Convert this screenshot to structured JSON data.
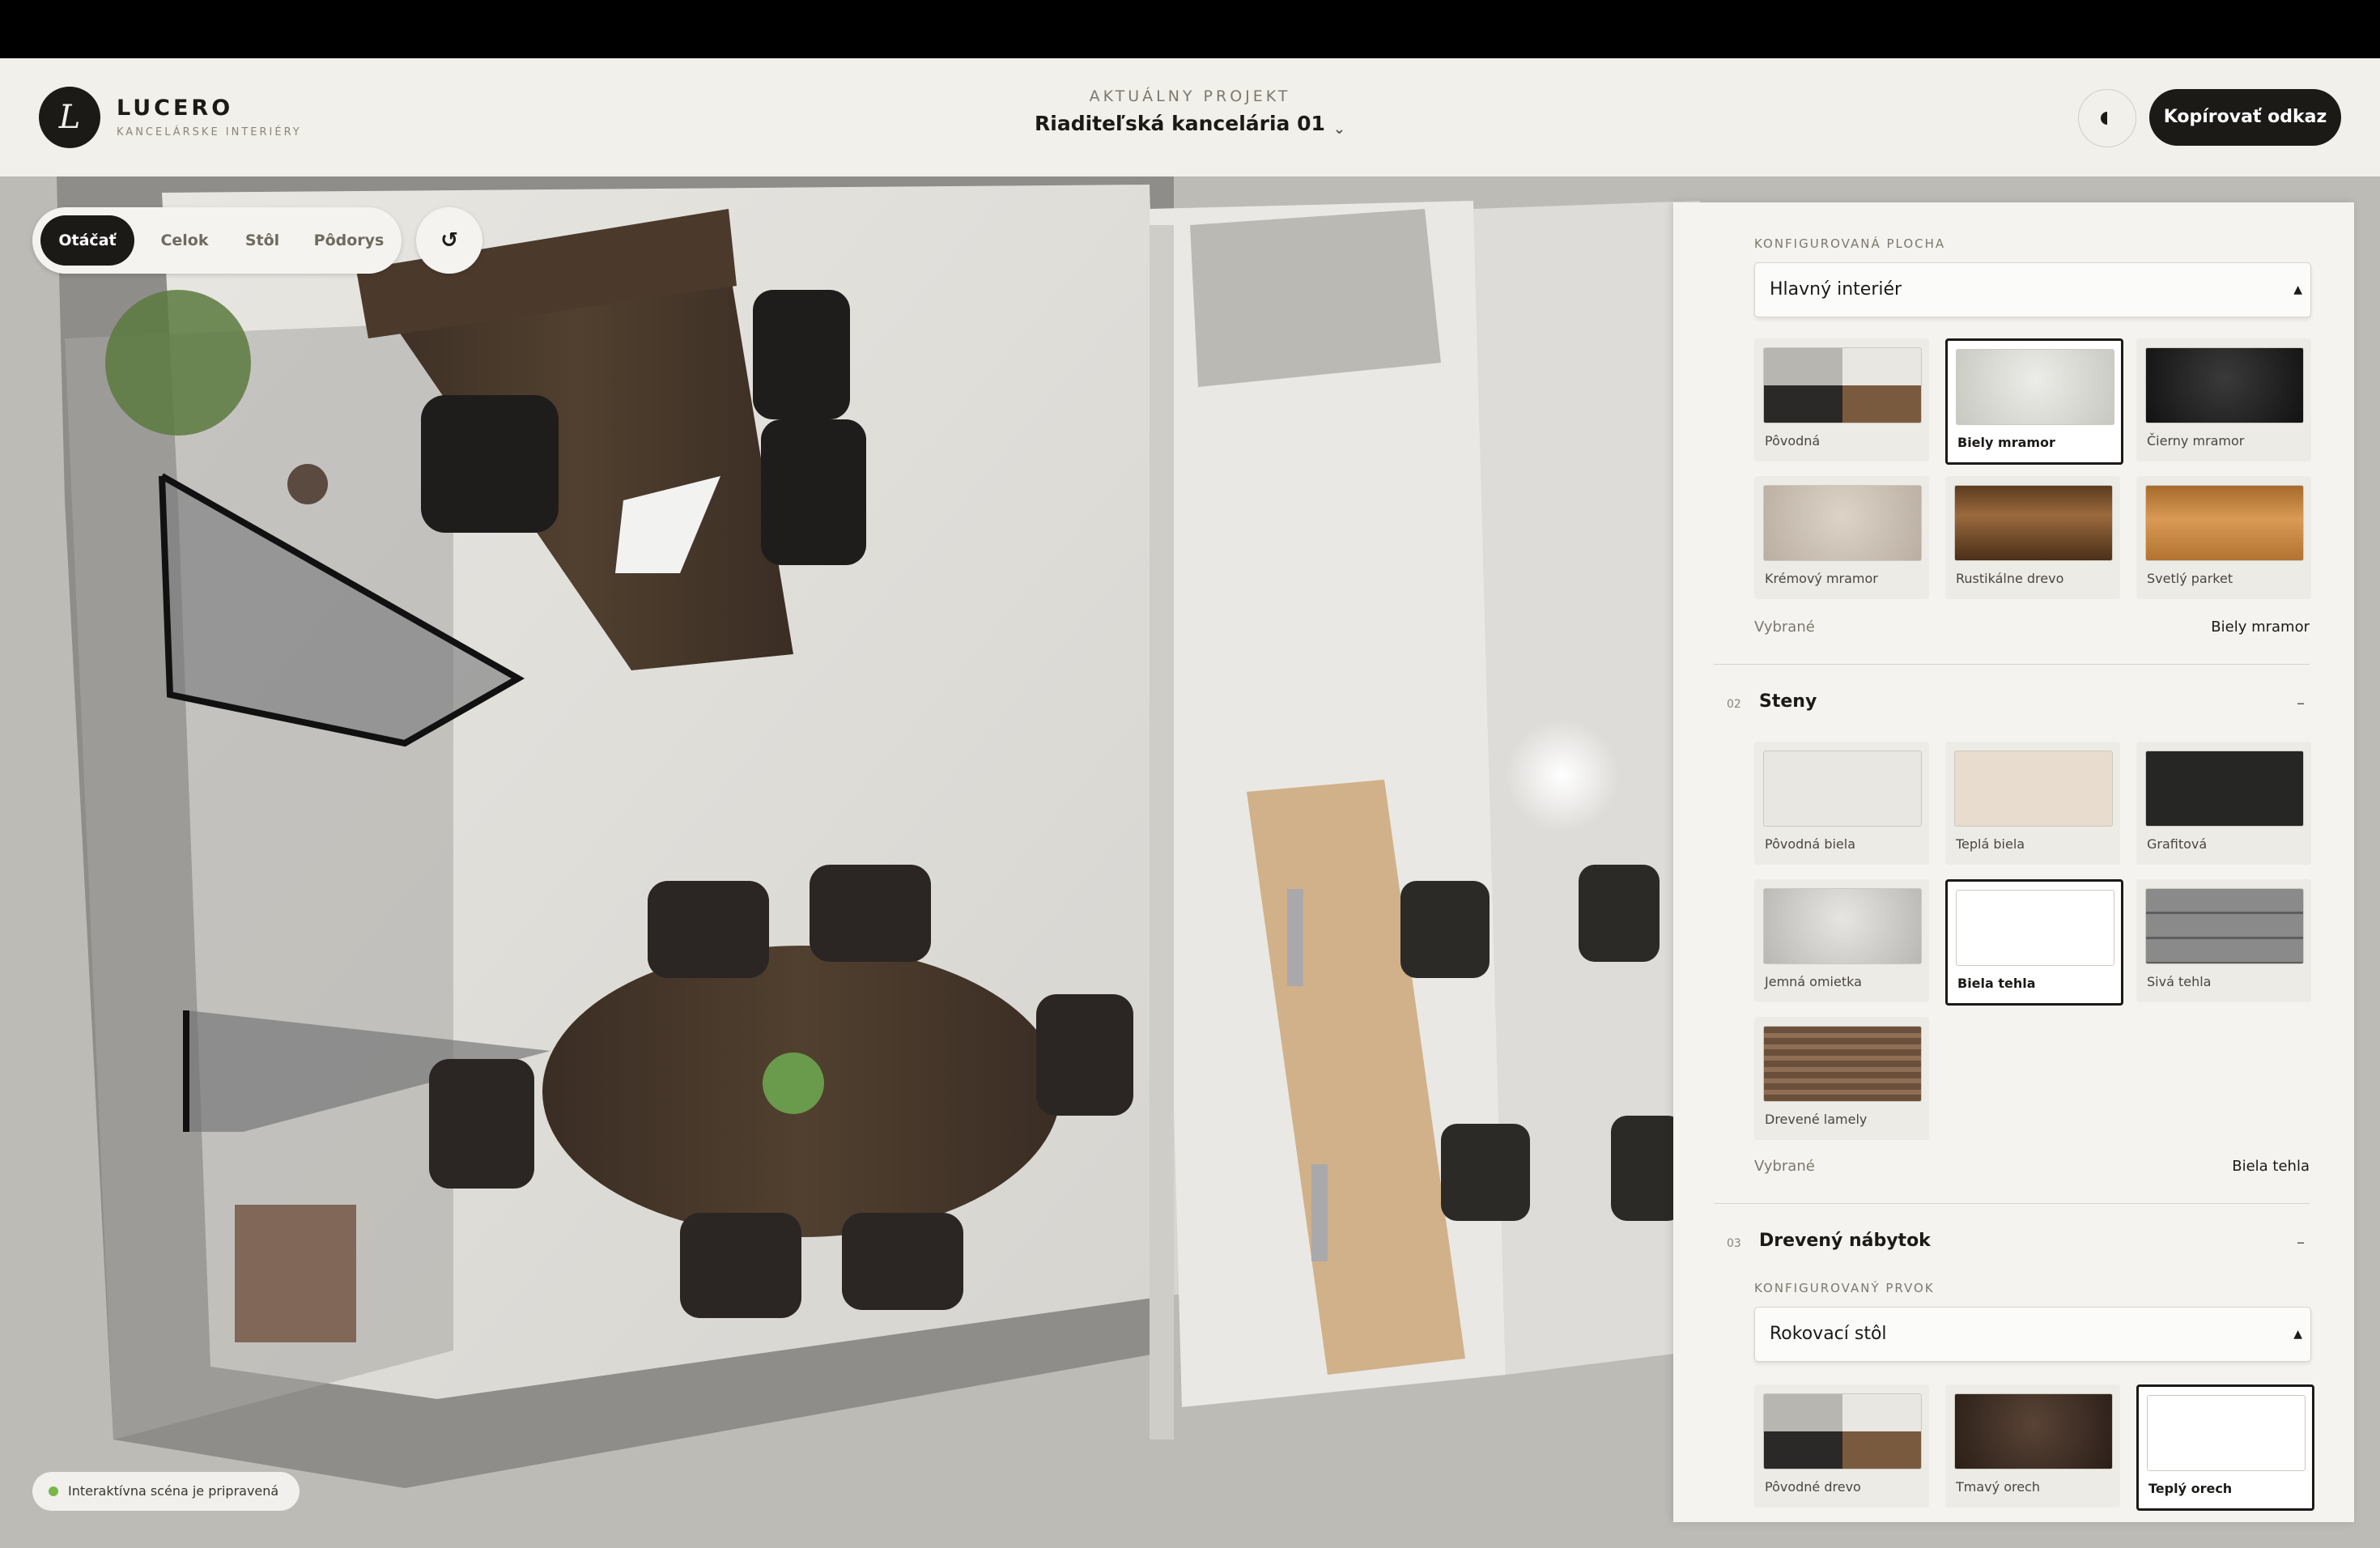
{
  "header": {
    "logo_letter": "L",
    "brand_name": "LUCERO",
    "brand_tagline": "KANCELÁRSKE INTERIÉRY",
    "project_label": "AKTUÁLNY PROJEKT",
    "project_name": "Riaditeľská kancelária 01",
    "copy_button": "Kopírovať odkaz",
    "theme_icon": "contrast-icon"
  },
  "scene_controls": {
    "tabs": [
      {
        "label": "Otáčať",
        "active": true
      },
      {
        "label": "Celok",
        "active": false
      },
      {
        "label": "Stôl",
        "active": false
      },
      {
        "label": "Pôdorys",
        "active": false
      }
    ],
    "reset_icon": "↺",
    "status": "Interaktívna scéna je pripravená"
  },
  "panel": {
    "floor": {
      "area_label": "KONFIGUROVANÁ PLOCHA",
      "area_value": "Hlavný interiér",
      "swatches": [
        "Pôvodná",
        "Biely mramor",
        "Čierny mramor",
        "Krémový mramor",
        "Rustikálne drevo",
        "Svetlý parket"
      ],
      "selected_label": "Vybrané",
      "selected_value": "Biely mramor"
    },
    "walls": {
      "number": "02",
      "title": "Steny",
      "toggle": "–",
      "swatches": [
        "Pôvodná biela",
        "Teplá biela",
        "Grafitová",
        "Jemná omietka",
        "Biela tehla",
        "Sivá tehla",
        "Drevené lamely"
      ],
      "selected_label": "Vybrané",
      "selected_value": "Biela tehla"
    },
    "furniture": {
      "number": "03",
      "title": "Drevený nábytok",
      "toggle": "–",
      "element_label": "KONFIGUROVANÝ PRVOK",
      "element_value": "Rokovací stôl",
      "swatches": [
        "Pôvodné drevo",
        "Tmavý orech",
        "Teplý orech"
      ]
    }
  }
}
